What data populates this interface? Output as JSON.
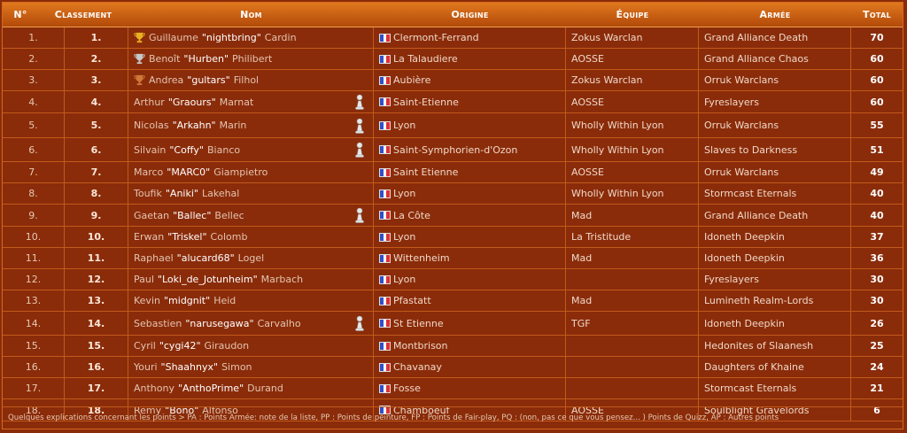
{
  "headers": {
    "no": "N°",
    "classement": "Classement",
    "nom": "Nom",
    "origine": "Origine",
    "equipe": "Équipe",
    "armee": "Armée",
    "total": "Total"
  },
  "rows": [
    {
      "no": "1.",
      "rank": "1.",
      "first": "Guillaume",
      "nick": "\"nightbring\"",
      "last": "Cardin",
      "origin": "Clermont-Ferrand",
      "team": "Zokus Warclan",
      "army": "Grand Alliance Death",
      "total": "70",
      "trophy": "gold",
      "pawn": false
    },
    {
      "no": "2.",
      "rank": "2.",
      "first": "Benoît",
      "nick": "\"Hurben\"",
      "last": "Philibert",
      "origin": "La Talaudiere",
      "team": "AOSSE",
      "army": "Grand Alliance Chaos",
      "total": "60",
      "trophy": "silver",
      "pawn": false
    },
    {
      "no": "3.",
      "rank": "3.",
      "first": "Andrea",
      "nick": "\"gultars\"",
      "last": "Filhol",
      "origin": "Aubière",
      "team": "Zokus Warclan",
      "army": "Orruk Warclans",
      "total": "60",
      "trophy": "bronze",
      "pawn": false
    },
    {
      "no": "4.",
      "rank": "4.",
      "first": "Arthur",
      "nick": "\"Graours\"",
      "last": "Marnat",
      "origin": "Saint-Etienne",
      "team": "AOSSE",
      "army": "Fyreslayers",
      "total": "60",
      "trophy": "",
      "pawn": true
    },
    {
      "no": "5.",
      "rank": "5.",
      "first": "Nicolas",
      "nick": "\"Arkahn\"",
      "last": "Marin",
      "origin": "Lyon",
      "team": "Wholly Within Lyon",
      "army": "Orruk Warclans",
      "total": "55",
      "trophy": "",
      "pawn": true
    },
    {
      "no": "6.",
      "rank": "6.",
      "first": "Silvain",
      "nick": "\"Coffy\"",
      "last": "Bianco",
      "origin": "Saint-Symphorien-d'Ozon",
      "team": "Wholly Within Lyon",
      "army": "Slaves to Darkness",
      "total": "51",
      "trophy": "",
      "pawn": true
    },
    {
      "no": "7.",
      "rank": "7.",
      "first": "Marco",
      "nick": "\"MARC0\"",
      "last": "Giampietro",
      "origin": "Saint Etienne",
      "team": "AOSSE",
      "army": "Orruk Warclans",
      "total": "49",
      "trophy": "",
      "pawn": false
    },
    {
      "no": "8.",
      "rank": "8.",
      "first": "Toufik",
      "nick": "\"Aniki\"",
      "last": "Lakehal",
      "origin": "Lyon",
      "team": "Wholly Within Lyon",
      "army": "Stormcast Eternals",
      "total": "40",
      "trophy": "",
      "pawn": false
    },
    {
      "no": "9.",
      "rank": "9.",
      "first": "Gaetan",
      "nick": "\"Ballec\"",
      "last": "Bellec",
      "origin": "La Côte",
      "team": "Mad",
      "army": "Grand Alliance Death",
      "total": "40",
      "trophy": "",
      "pawn": true
    },
    {
      "no": "10.",
      "rank": "10.",
      "first": "Erwan",
      "nick": "\"Triskel\"",
      "last": "Colomb",
      "origin": "Lyon",
      "team": "La Tristitude",
      "army": "Idoneth Deepkin",
      "total": "37",
      "trophy": "",
      "pawn": false
    },
    {
      "no": "11.",
      "rank": "11.",
      "first": "Raphael",
      "nick": "\"alucard68\"",
      "last": "Logel",
      "origin": "Wittenheim",
      "team": "Mad",
      "army": "Idoneth Deepkin",
      "total": "36",
      "trophy": "",
      "pawn": false
    },
    {
      "no": "12.",
      "rank": "12.",
      "first": "Paul",
      "nick": "\"Loki_de_Jotunheim\"",
      "last": "Marbach",
      "origin": "Lyon",
      "team": "",
      "army": "Fyreslayers",
      "total": "30",
      "trophy": "",
      "pawn": false
    },
    {
      "no": "13.",
      "rank": "13.",
      "first": "Kevin",
      "nick": "\"midgnit\"",
      "last": "Heid",
      "origin": "Pfastatt",
      "team": "Mad",
      "army": "Lumineth Realm-Lords",
      "total": "30",
      "trophy": "",
      "pawn": false
    },
    {
      "no": "14.",
      "rank": "14.",
      "first": "Sebastien",
      "nick": "\"narusegawa\"",
      "last": "Carvalho",
      "origin": "St Etienne",
      "team": "TGF",
      "army": "Idoneth Deepkin",
      "total": "26",
      "trophy": "",
      "pawn": true
    },
    {
      "no": "15.",
      "rank": "15.",
      "first": "Cyril",
      "nick": "\"cygi42\"",
      "last": "Giraudon",
      "origin": "Montbrison",
      "team": "",
      "army": "Hedonites of Slaanesh",
      "total": "25",
      "trophy": "",
      "pawn": false
    },
    {
      "no": "16.",
      "rank": "16.",
      "first": "Youri",
      "nick": "\"Shaahnyx\"",
      "last": "Simon",
      "origin": "Chavanay",
      "team": "",
      "army": "Daughters of Khaine",
      "total": "24",
      "trophy": "",
      "pawn": false
    },
    {
      "no": "17.",
      "rank": "17.",
      "first": "Anthony",
      "nick": "\"AnthoPrime\"",
      "last": "Durand",
      "origin": "Fosse",
      "team": "",
      "army": "Stormcast Eternals",
      "total": "21",
      "trophy": "",
      "pawn": false
    },
    {
      "no": "18.",
      "rank": "18.",
      "first": "Remy",
      "nick": "\"Bono\"",
      "last": "Alfonso",
      "origin": "Chamboeuf",
      "team": "AOSSE",
      "army": "Soulblight Gravelords",
      "total": "6",
      "trophy": "",
      "pawn": false
    }
  ],
  "row_heights_note": "",
  "footer": "Quelques explications concernant les points > PA : Points Armée: note de la liste, PP : Points de peinture, FP : Points de Fair-play, PQ : (non, pas ce que vous pensez... ) Points de Quizz, AP : Autres points",
  "colors": {
    "gold": "#e8b020",
    "silver": "#c8c8c8",
    "bronze": "#d07838",
    "flag_blue": "#3050c8",
    "flag_white": "#ffffff",
    "flag_red": "#e03030"
  }
}
